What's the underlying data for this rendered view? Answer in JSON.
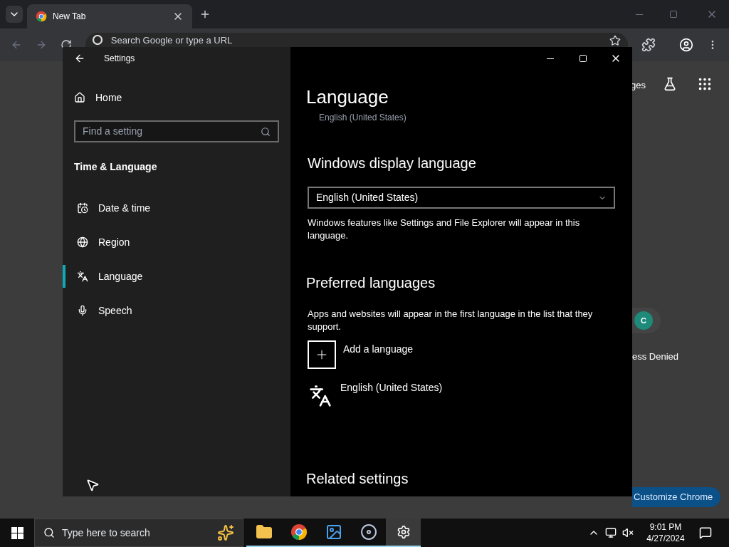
{
  "browser": {
    "tabs": [
      {
        "title": "New Tab",
        "selected": true
      }
    ],
    "omnibox": {
      "placeholder": "Search Google or type a URL"
    },
    "header_link": "ges",
    "shortcut": {
      "initial": "C",
      "label": "ess Denied",
      "color": "#1e8a7a"
    },
    "customize_button": "Customize Chrome"
  },
  "settings": {
    "title": "Settings",
    "home": "Home",
    "search": {
      "placeholder": "Find a setting"
    },
    "section": "Time & Language",
    "nav": [
      {
        "label": "Date & time",
        "kind": "calendar",
        "selected": false
      },
      {
        "label": "Region",
        "kind": "globe",
        "selected": false
      },
      {
        "label": "Language",
        "kind": "language",
        "selected": true
      },
      {
        "label": "Speech",
        "kind": "mic",
        "selected": false
      }
    ],
    "page": {
      "title": "Language",
      "current_language": "English (United States)",
      "display": {
        "heading": "Windows display language",
        "value": "English (United States)",
        "note": "Windows features like Settings and File Explorer will appear in this language."
      },
      "preferred": {
        "heading": "Preferred languages",
        "note": "Apps and websites will appear in the first language in the list that they support.",
        "add": "Add a language",
        "languages": [
          "English (United States)"
        ]
      },
      "related": "Related settings"
    }
  },
  "taskbar": {
    "search": {
      "placeholder": "Type here to search"
    },
    "apps": [
      {
        "kind": "folder",
        "selected": false
      },
      {
        "kind": "chrome",
        "selected": false
      },
      {
        "kind": "photos",
        "selected": false
      },
      {
        "kind": "disc",
        "selected": false
      },
      {
        "kind": "settings",
        "selected": true
      }
    ],
    "time": "9:01 PM",
    "date": "4/27/2024"
  }
}
